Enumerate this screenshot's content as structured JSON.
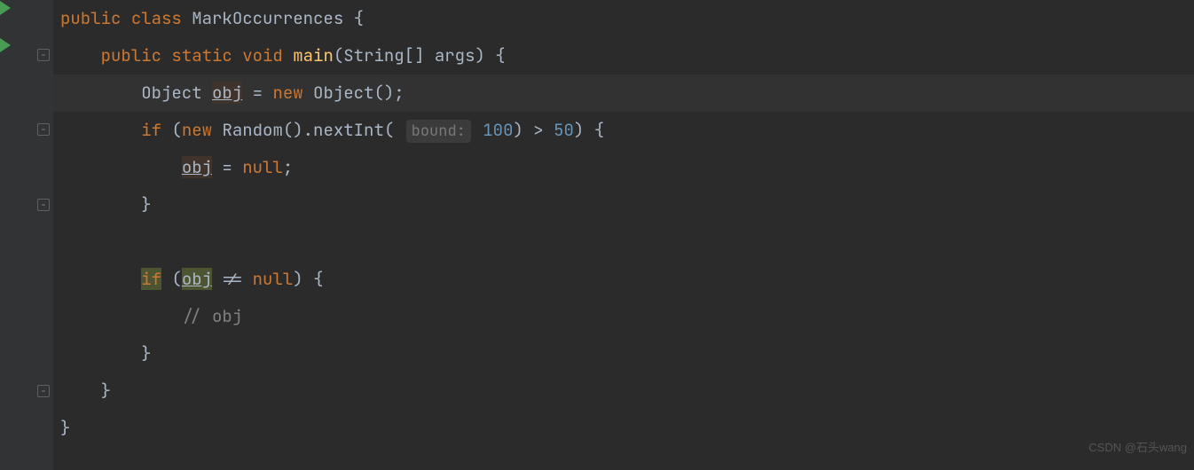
{
  "code": {
    "line1": {
      "kw1": "public",
      "kw2": "class",
      "className": "MarkOccurrences",
      "brace": "{"
    },
    "line2": {
      "kw1": "public",
      "kw2": "static",
      "kw3": "void",
      "method": "main",
      "paramType": "String[]",
      "paramName": "args",
      "braceOpen": "{"
    },
    "line3": {
      "type": "Object",
      "varName": "obj",
      "eq": "=",
      "kw": "new",
      "ctor": "Object()",
      "semi": ";"
    },
    "line4": {
      "kw1": "if",
      "parenO": "(",
      "kw2": "new",
      "ctor": "Random()",
      "dot": ".",
      "method": "nextInt(",
      "hintLabel": "bound:",
      "num": "100",
      "close": ")",
      "gt": ">",
      "num2": "50",
      "parenC": ")",
      "brace": "{"
    },
    "line5": {
      "varName": "obj",
      "eq": "=",
      "nullKw": "null",
      "semi": ";"
    },
    "line6": {
      "brace": "}"
    },
    "line7": {
      "kw1": "if",
      "parenO": "(",
      "varName": "obj",
      "neq": "!=",
      "nullKw": "null",
      "parenC": ")",
      "brace": "{"
    },
    "line8": {
      "comment": "// obj"
    },
    "line9": {
      "brace": "}"
    },
    "line10": {
      "brace": "}"
    },
    "line11": {
      "brace": "}"
    }
  },
  "watermark": "CSDN @石头wang"
}
